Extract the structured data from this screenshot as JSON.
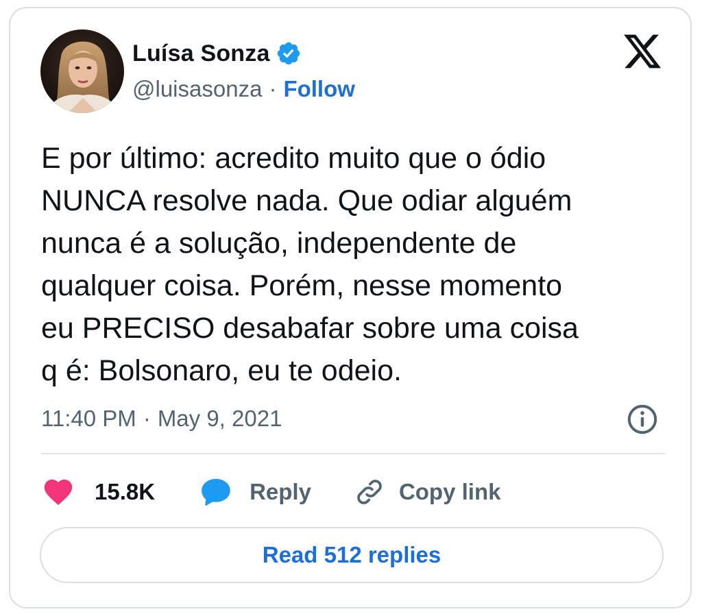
{
  "author": {
    "name": "Luísa Sonza",
    "handle": "@luisasonza",
    "separator": "·",
    "follow_label": "Follow",
    "verified_icon": "verified-badge-icon"
  },
  "platform_logo": "x-logo-icon",
  "tweet": {
    "text": "E por último: acredito muito que o ódio\nNUNCA resolve nada. Que odiar alguém\nnunca é a solução, independente de\nqualquer coisa. Porém, nesse momento\neu PRECISO desabafar sobre uma coisa\nq é: Bolsonaro, eu te odeio.",
    "time": "11:40 PM",
    "separator": "·",
    "date": "May 9, 2021"
  },
  "actions": {
    "like_count": "15.8K",
    "reply_label": "Reply",
    "copy_link_label": "Copy link"
  },
  "read_replies_label": "Read 512 replies",
  "colors": {
    "accent": "#1d6fd6",
    "heart": "#f0357a",
    "reply_bubble": "#1d9bf0",
    "text_primary": "#0f1419",
    "text_secondary": "#536471",
    "border": "#d9dee3"
  }
}
